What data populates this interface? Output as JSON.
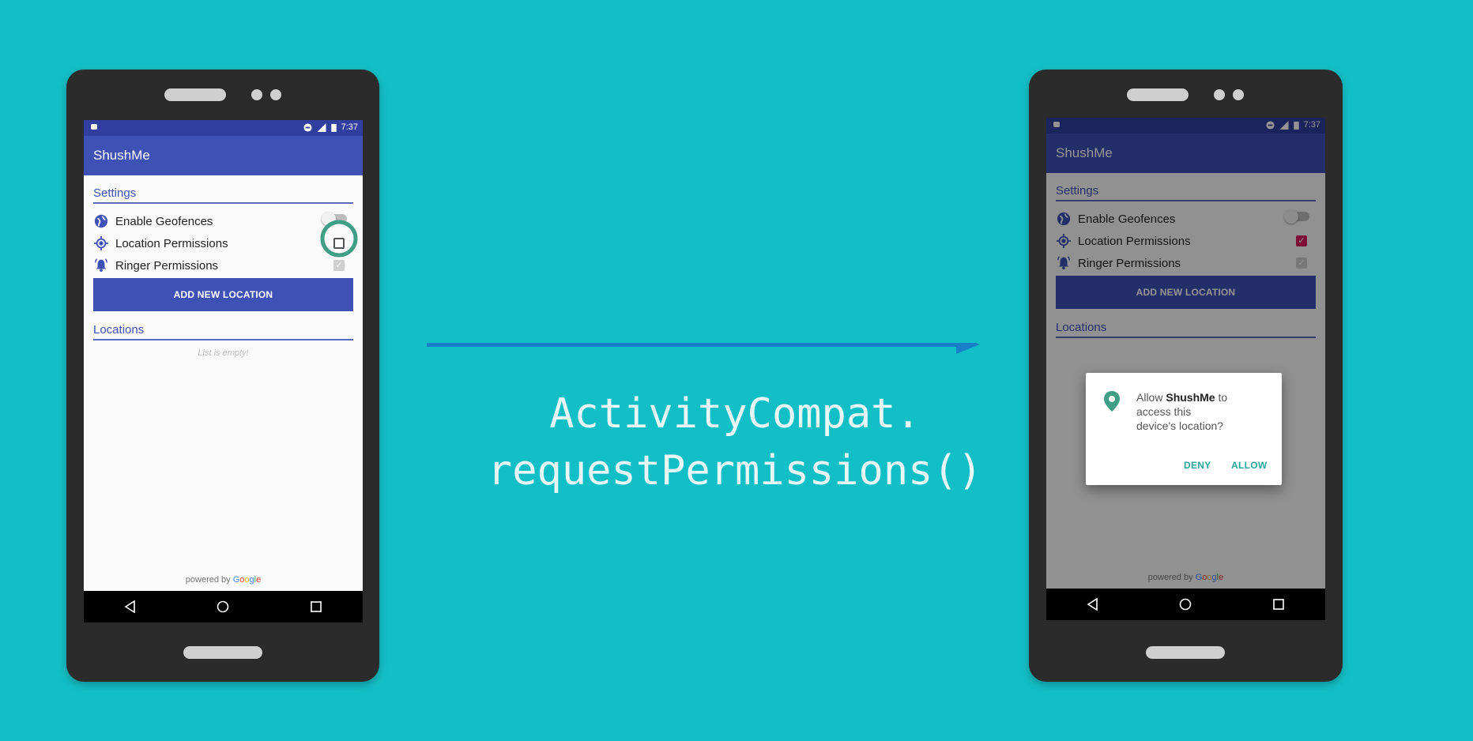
{
  "colors": {
    "background": "#13bfc6",
    "primary": "#3f51b5",
    "primary_dark": "#303f9f",
    "accent": "#d81b60",
    "dialog_button": "#26a69a",
    "highlight_ring": "#3f9e86"
  },
  "code": {
    "line1": "ActivityCompat.",
    "line2": "requestPermissions()"
  },
  "left_phone": {
    "status_time": "7:37",
    "app_title": "ShushMe",
    "settings_title": "Settings",
    "rows": [
      {
        "label": "Enable Geofences",
        "icon": "globe-icon",
        "control": "switch-off"
      },
      {
        "label": "Location Permissions",
        "icon": "location-target-icon",
        "control": "checkbox-unchecked"
      },
      {
        "label": "Ringer Permissions",
        "icon": "bell-icon",
        "control": "checkbox-checked-disabled"
      }
    ],
    "add_button": "ADD NEW LOCATION",
    "locations_title": "Locations",
    "empty_text": "List is empty!",
    "powered_by": "powered by",
    "google": [
      "G",
      "o",
      "o",
      "g",
      "l",
      "e"
    ]
  },
  "right_phone": {
    "status_time": "7:37",
    "app_title": "ShushMe",
    "settings_title": "Settings",
    "rows": [
      {
        "label": "Enable Geofences",
        "icon": "globe-icon",
        "control": "switch-off"
      },
      {
        "label": "Location Permissions",
        "icon": "location-target-icon",
        "control": "checkbox-checked"
      },
      {
        "label": "Ringer Permissions",
        "icon": "bell-icon",
        "control": "checkbox-checked-disabled"
      }
    ],
    "add_button": "ADD NEW LOCATION",
    "locations_title": "Locations",
    "powered_by": "powered by",
    "google": [
      "G",
      "o",
      "o",
      "g",
      "l",
      "e"
    ],
    "dialog": {
      "allow_word": "Allow",
      "app_name": "ShushMe",
      "message_rest": "to access this device's location?",
      "deny": "DENY",
      "allow": "ALLOW"
    }
  }
}
